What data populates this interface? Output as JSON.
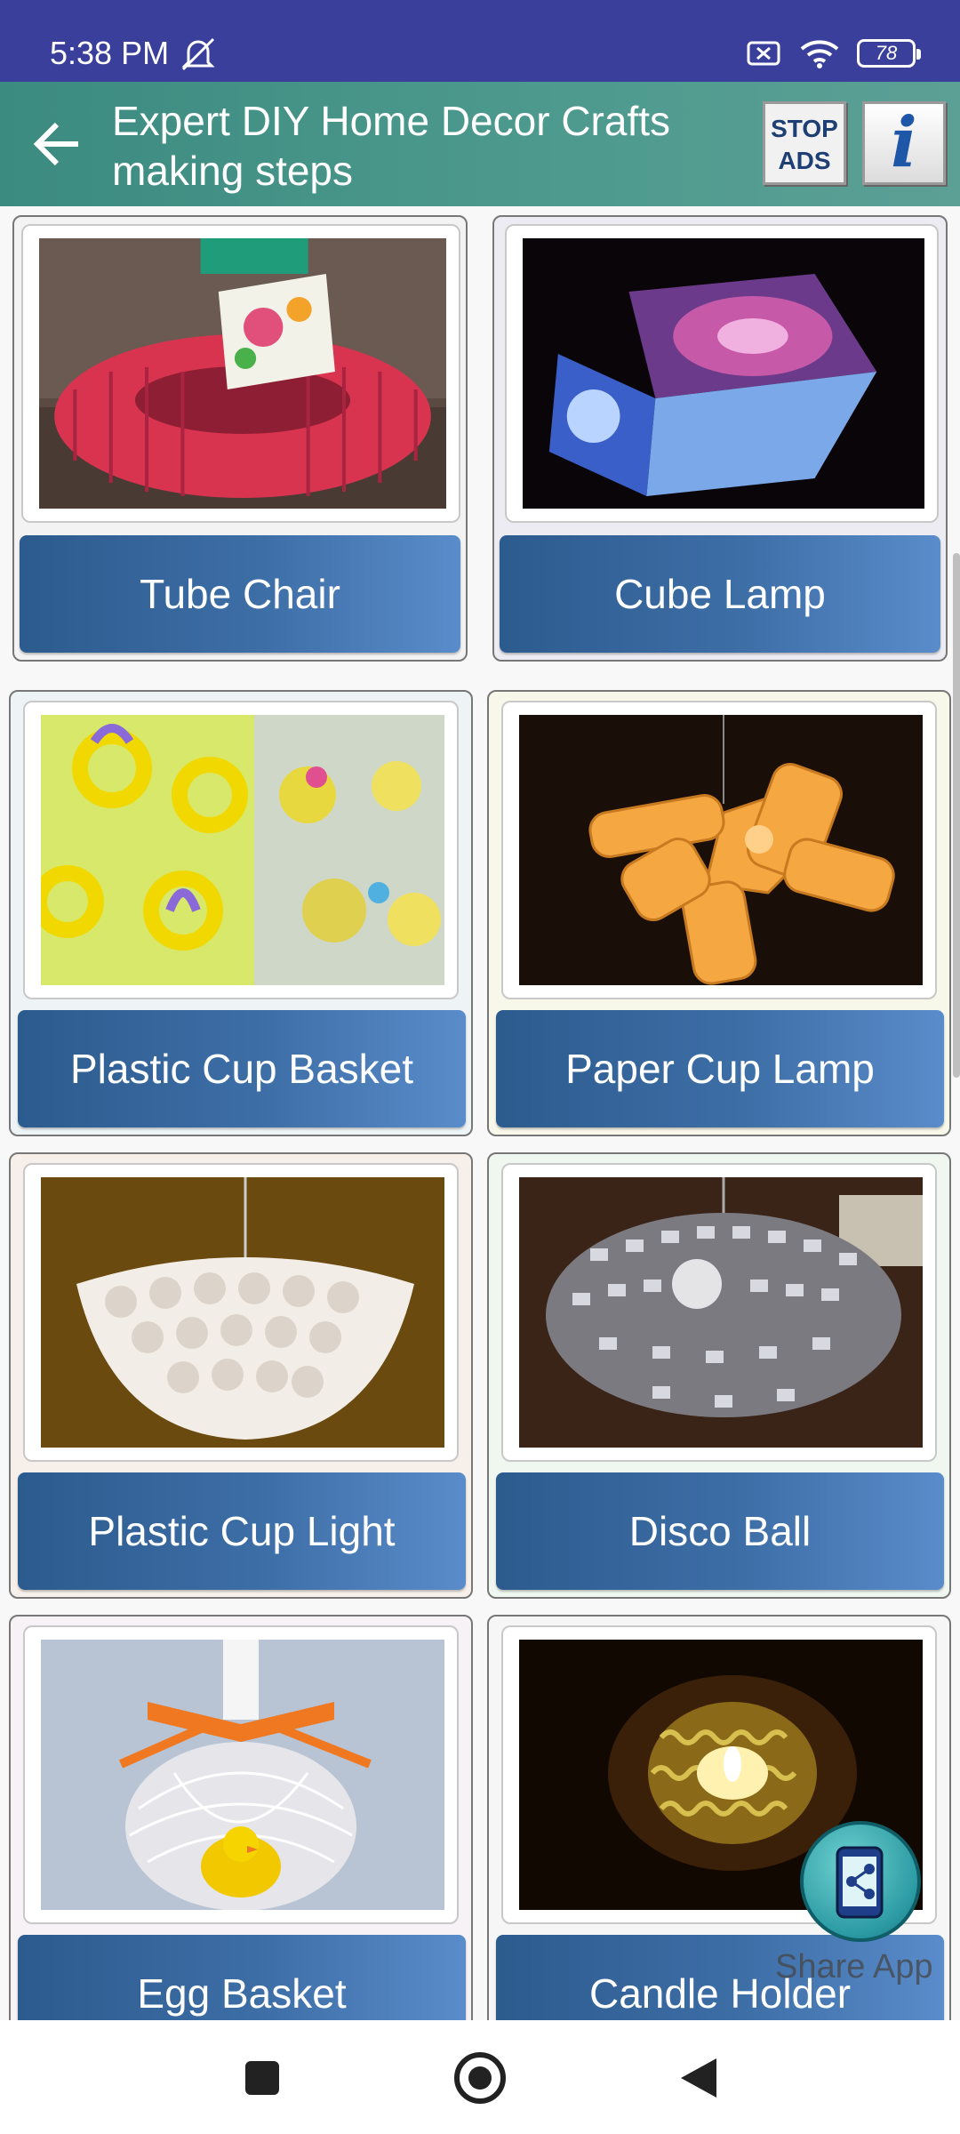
{
  "status_bar": {
    "time": "5:38 PM",
    "battery": "78"
  },
  "app_bar": {
    "title": "Expert DIY Home Decor Crafts making steps",
    "stop_ads": "STOP ADS",
    "info": "i"
  },
  "items": [
    {
      "label": "Tube Chair"
    },
    {
      "label": "Cube Lamp"
    },
    {
      "label": "Plastic Cup Basket"
    },
    {
      "label": "Paper Cup Lamp"
    },
    {
      "label": "Plastic Cup Light"
    },
    {
      "label": "Disco Ball"
    },
    {
      "label": "Egg Basket"
    },
    {
      "label": "Candle Holder"
    }
  ],
  "share": {
    "label": "Share App"
  },
  "colors": {
    "status_bar": "#3a3f9c",
    "app_bar": "#4e9a8e",
    "label_button": "#3d6ea6"
  }
}
